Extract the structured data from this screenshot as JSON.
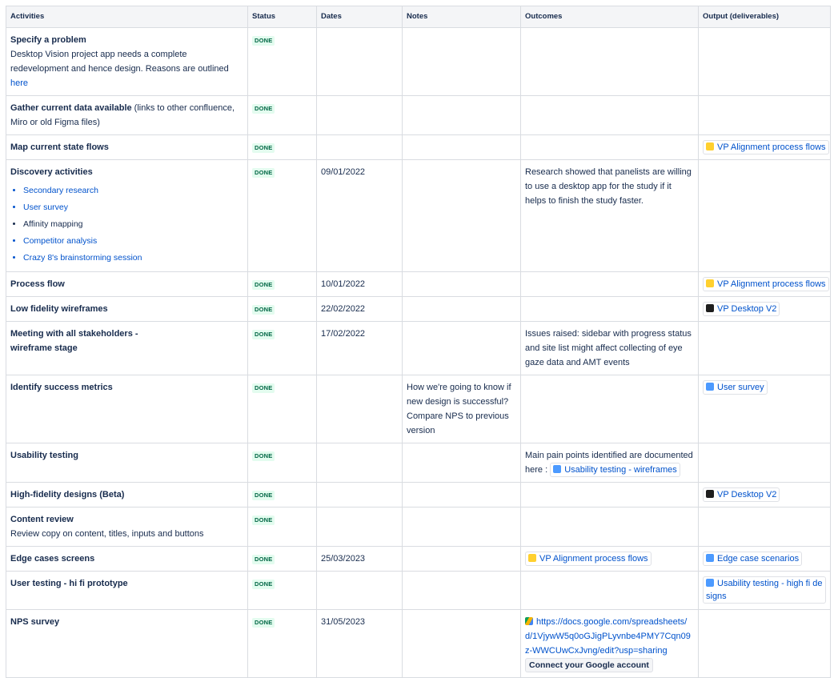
{
  "headers": [
    "Activities",
    "Status",
    "Dates",
    "Notes",
    "Outcomes",
    "Output (deliverables)"
  ],
  "status_label": "DONE",
  "rows": [
    {
      "activity": "Specify a problem",
      "desc": "Desktop Vision project app needs a complete redevelopment and hence design. Reasons are outlined ",
      "desc_link": "here"
    },
    {
      "activity": "Gather current data available",
      "activity_suffix": " (links to other confluence, Miro or old Figma files)"
    },
    {
      "activity": "Map current state flows",
      "output": "VP Alignment process flows"
    },
    {
      "activity": "Discovery activities",
      "date": "09/01/2022",
      "list": [
        "Secondary research",
        "User survey",
        "Affinity mapping",
        "Competitor analysis",
        "Crazy 8's brainstorming session"
      ],
      "outcome": "Research showed that panelists are willing to use a desktop app for the study if it helps to finish the study faster."
    },
    {
      "activity": "Process flow",
      "date": "10/01/2022",
      "output": "VP Alignment process flows"
    },
    {
      "activity": "Low fidelity wireframes",
      "date": "22/02/2022",
      "output": "VP Desktop V2"
    },
    {
      "activity": "Meeting with all stakeholders - wireframe stage",
      "date": "17/02/2022",
      "outcome": "Issues raised: sidebar with progress status and site list might affect collecting of eye gaze data and AMT events"
    },
    {
      "activity": "Identify success metrics",
      "note": "How we're going to know if new design is successful? Compare NPS to previous version",
      "output": "User survey"
    },
    {
      "activity": "Usability testing",
      "outcome_text": "Main pain points identified are documented here : ",
      "outcome_chip": "Usability testing - wireframes"
    },
    {
      "activity": "High-fidelity designs (Beta)",
      "output": "VP Desktop V2"
    },
    {
      "activity": "Content review",
      "desc": "Review copy on content, titles, inputs and buttons"
    },
    {
      "activity": "Edge cases screens",
      "date": "25/03/2023",
      "outcome_chip": "VP Alignment process flows",
      "output": "Edge case scenarios"
    },
    {
      "activity": "User testing - hi fi prototype",
      "output": "Usability testing - high fi designs"
    },
    {
      "activity": "NPS survey",
      "date": "31/05/2023",
      "outcome_url": "https://docs.google.com/spreadsheets/d/1VjywW5q0oGJigPLyvnbe4PMY7Cqn09z-WWCUwCxJvng/edit?usp=sharing",
      "outcome_button": "Connect your Google account"
    }
  ]
}
